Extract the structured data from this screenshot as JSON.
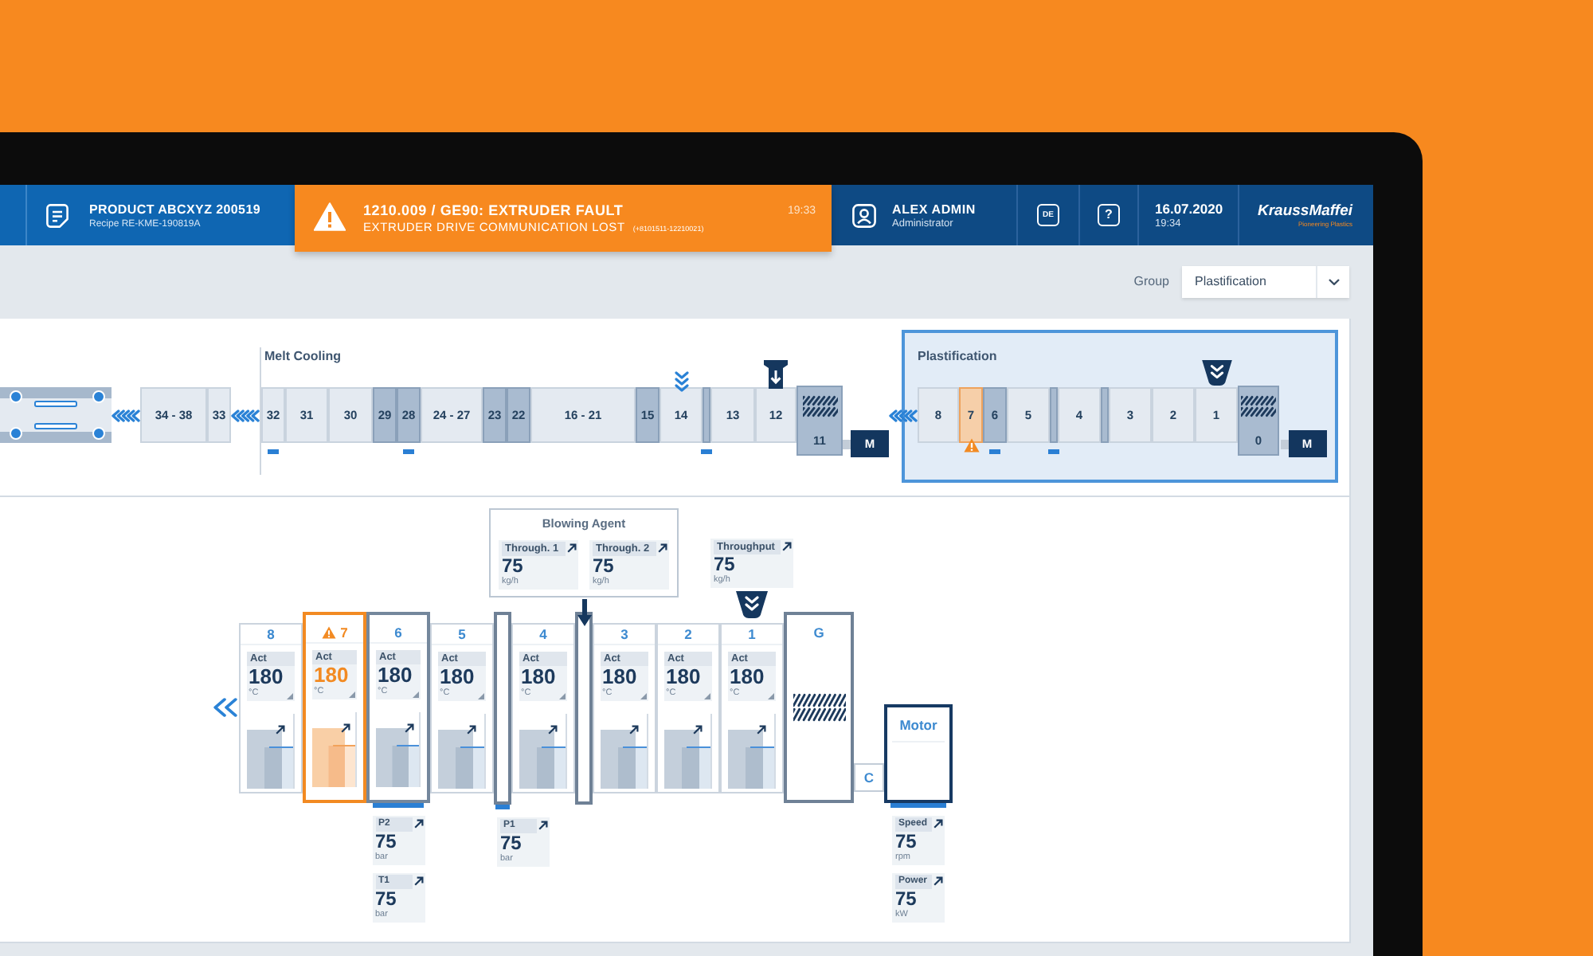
{
  "header": {
    "product": {
      "title": "PRODUCT ABCXYZ 200519",
      "recipe": "Recipe RE-KME-190819A"
    },
    "alarm": {
      "title": "1210.009 / GE90: EXTRUDER FAULT",
      "message": "EXTRUDER DRIVE COMMUNICATION LOST",
      "code": "(+8101511-12210021)",
      "time": "19:33"
    },
    "user": {
      "name": "ALEX ADMIN",
      "role": "Administrator"
    },
    "language": "DE",
    "help": "?",
    "clock": {
      "date": "16.07.2020",
      "time": "19:34"
    },
    "logo": {
      "name": "KraussMaffei",
      "tagline": "Pioneering Plastics"
    }
  },
  "toolbar": {
    "label": "Group",
    "value": "Plastification"
  },
  "overview": {
    "segments": [
      {
        "kind": "die",
        "sensor": false,
        "alarm": false
      },
      {
        "kind": "flow",
        "sensor": false,
        "alarm": false
      },
      {
        "kind": "transition",
        "label": "34 - 38",
        "sensor": false,
        "alarm": false
      },
      {
        "kind": "zone",
        "label": "33",
        "sensor": false,
        "alarm": false
      },
      {
        "kind": "flow",
        "sensor": false,
        "alarm": false
      }
    ],
    "sections": [
      {
        "title": "Melt Cooling",
        "selected": false,
        "segments": [
          {
            "kind": "zone",
            "label": "32",
            "sensor": true,
            "alarm": false
          },
          {
            "kind": "zone",
            "label": "31",
            "sensor": false,
            "alarm": false
          },
          {
            "kind": "zone",
            "label": "30",
            "sensor": false,
            "alarm": false
          },
          {
            "kind": "cooled",
            "label": "29",
            "sensor": false,
            "alarm": false
          },
          {
            "kind": "cooled",
            "label": "28",
            "sensor": true,
            "alarm": false
          },
          {
            "kind": "zone",
            "label": "24 - 27",
            "sensor": false,
            "alarm": false
          },
          {
            "kind": "cooled",
            "label": "23",
            "sensor": false,
            "alarm": false
          },
          {
            "kind": "cooled",
            "label": "22",
            "sensor": false,
            "alarm": false
          },
          {
            "kind": "zone",
            "label": "16 - 21",
            "sensor": false,
            "alarm": false
          },
          {
            "kind": "cooled",
            "label": "15",
            "sensor": false,
            "alarm": false
          },
          {
            "kind": "zone",
            "label": "14",
            "feeder": {
              "kind": "chevrons"
            },
            "sensor": false,
            "alarm": false
          },
          {
            "kind": "vent",
            "sensor": true,
            "alarm": false
          },
          {
            "kind": "zone",
            "label": "13",
            "sensor": false,
            "alarm": false
          },
          {
            "kind": "zone",
            "label": "12",
            "feeder": {
              "kind": "funnel"
            },
            "sensor": false,
            "alarm": false
          },
          {
            "kind": "screw",
            "label": "11",
            "sensor": false,
            "alarm": false
          },
          {
            "kind": "motor",
            "label": "M",
            "sensor": false,
            "alarm": false
          }
        ]
      },
      {
        "title": "Plastification",
        "selected": true,
        "segments": [
          {
            "kind": "flow",
            "sensor": false,
            "alarm": false
          },
          {
            "kind": "zone",
            "label": "8",
            "sensor": false,
            "alarm": false
          },
          {
            "kind": "zone",
            "label": "7",
            "sensor": false,
            "alarm": true
          },
          {
            "kind": "cooled",
            "label": "6",
            "sensor": true,
            "alarm": false
          },
          {
            "kind": "zone",
            "label": "5",
            "sensor": false,
            "alarm": false
          },
          {
            "kind": "vent",
            "sensor": true,
            "alarm": false
          },
          {
            "kind": "zone",
            "label": "4",
            "sensor": false,
            "alarm": false
          },
          {
            "kind": "vent",
            "sensor": false,
            "alarm": false
          },
          {
            "kind": "zone",
            "label": "3",
            "sensor": false,
            "alarm": false
          },
          {
            "kind": "zone",
            "label": "2",
            "sensor": false,
            "alarm": false
          },
          {
            "kind": "zone",
            "label": "1",
            "feeder": {
              "kind": "hopper"
            },
            "sensor": false,
            "alarm": false
          },
          {
            "kind": "screw",
            "label": "0",
            "sensor": false,
            "alarm": false
          },
          {
            "kind": "motor",
            "label": "M",
            "sensor": false,
            "alarm": false
          }
        ]
      }
    ]
  },
  "detail": {
    "inlets": [
      {
        "kind": "panel",
        "title": "Blowing Agent",
        "readings": [
          {
            "label": "Through. 1",
            "value": "75",
            "unit": "kg/h"
          },
          {
            "label": "Through. 2",
            "value": "75",
            "unit": "kg/h"
          }
        ]
      },
      {
        "kind": "card",
        "readings": [
          {
            "label": "Throughput",
            "value": "75",
            "unit": "kg/h"
          }
        ]
      }
    ],
    "items": [
      {
        "kind": "flow",
        "alarm": false
      },
      {
        "kind": "zone",
        "label": "8",
        "alarm": false,
        "reading": {
          "label": "Act",
          "value": "180",
          "unit": "°C"
        }
      },
      {
        "kind": "zone",
        "label": "7",
        "alarm": true,
        "reading": {
          "label": "Act",
          "value": "180",
          "unit": "°C"
        }
      },
      {
        "kind": "cooled",
        "label": "6",
        "alarm": false,
        "reading": {
          "label": "Act",
          "value": "180",
          "unit": "°C"
        },
        "sensors": [
          {
            "label": "P2",
            "value": "75",
            "unit": "bar"
          },
          {
            "label": "T1",
            "value": "75",
            "unit": "bar"
          }
        ]
      },
      {
        "kind": "zone",
        "label": "5",
        "alarm": false,
        "reading": {
          "label": "Act",
          "value": "180",
          "unit": "°C"
        }
      },
      {
        "kind": "vent",
        "alarm": false,
        "sensors": [
          {
            "label": "P1",
            "value": "75",
            "unit": "bar"
          }
        ]
      },
      {
        "kind": "zone",
        "label": "4",
        "alarm": false,
        "reading": {
          "label": "Act",
          "value": "180",
          "unit": "°C"
        }
      },
      {
        "kind": "vent",
        "alarm": false,
        "inlet": {
          "kind": "arrow"
        }
      },
      {
        "kind": "zone",
        "label": "3",
        "alarm": false,
        "reading": {
          "label": "Act",
          "value": "180",
          "unit": "°C"
        }
      },
      {
        "kind": "zone",
        "label": "2",
        "alarm": false,
        "reading": {
          "label": "Act",
          "value": "180",
          "unit": "°C"
        }
      },
      {
        "kind": "zone",
        "label": "1",
        "alarm": false,
        "reading": {
          "label": "Act",
          "value": "180",
          "unit": "°C"
        },
        "inlet": {
          "kind": "hopper"
        }
      },
      {
        "kind": "gear",
        "label": "G",
        "alarm": false
      },
      {
        "kind": "coupling",
        "label": "C",
        "alarm": false
      },
      {
        "kind": "motor",
        "label": "Motor",
        "alarm": false,
        "sensors": [
          {
            "label": "Speed",
            "value": "75",
            "unit": "rpm"
          },
          {
            "label": "Power",
            "value": "75",
            "unit": "kW"
          }
        ]
      }
    ]
  }
}
